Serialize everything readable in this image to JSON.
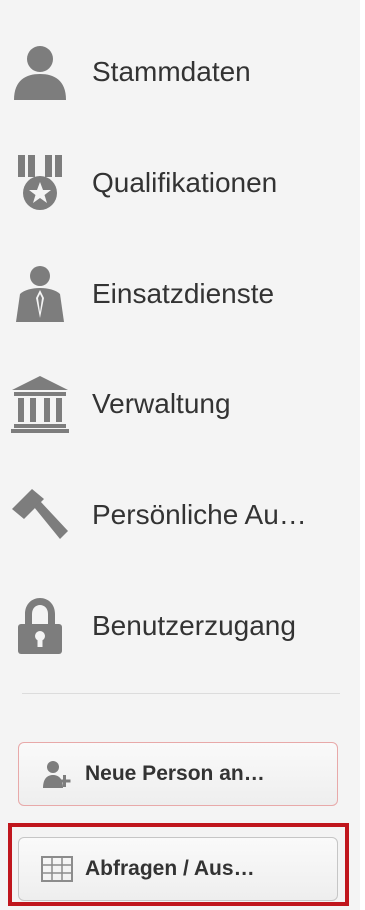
{
  "nav": {
    "items": [
      {
        "label": "Stammdaten",
        "icon": "user-icon"
      },
      {
        "label": "Qualifikationen",
        "icon": "medal-icon"
      },
      {
        "label": "Einsatzdienste",
        "icon": "service-person-icon"
      },
      {
        "label": "Verwaltung",
        "icon": "institution-icon"
      },
      {
        "label": "Persönliche Au…",
        "icon": "hammer-icon"
      },
      {
        "label": "Benutzerzugang",
        "icon": "lock-icon"
      }
    ]
  },
  "actions": {
    "new_person_label": "Neue Person an…",
    "query_label": "Abfragen / Aus…"
  },
  "colors": {
    "icon": "#7d7d7d",
    "text": "#333333",
    "highlight": "#c0161d",
    "new_button_border": "#e8a9a9"
  }
}
